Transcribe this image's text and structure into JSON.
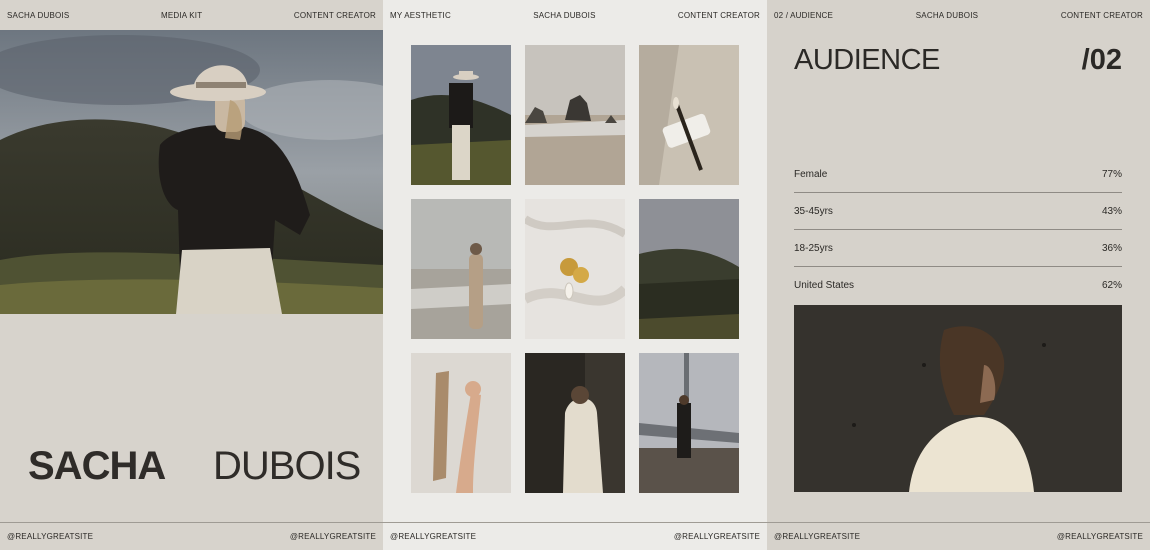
{
  "page1": {
    "header": {
      "left": "SACHA DUBOIS",
      "center": "MEDIA KIT",
      "right": "CONTENT CREATOR"
    },
    "first_name": "SACHA",
    "last_name": "DUBOIS",
    "footer": {
      "left": "@REALLYGREATSITE",
      "right": "@REALLYGREATSITE"
    }
  },
  "page2": {
    "header": {
      "left": "MY AESTHETIC",
      "center": "SACHA DUBOIS",
      "right": "CONTENT CREATOR"
    },
    "footer": {
      "left": "@REALLYGREATSITE",
      "right": "@REALLYGREATSITE"
    }
  },
  "page3": {
    "header": {
      "left": "02 / AUDIENCE",
      "center": "SACHA DUBOIS",
      "right": "CONTENT CREATOR"
    },
    "title": "AUDIENCE",
    "number": "/02",
    "stats": [
      {
        "label": "Female",
        "value": "77%"
      },
      {
        "label": "35-45yrs",
        "value": "43%"
      },
      {
        "label": "18-25yrs",
        "value": "36%"
      },
      {
        "label": "United States",
        "value": "62%"
      }
    ],
    "footer": {
      "left": "@REALLYGREATSITE",
      "right": "@REALLYGREATSITE"
    }
  },
  "colors": {
    "page_bg": "#d7d3cc",
    "gallery_bg": "#ecebe8",
    "text": "#2b2926",
    "rule": "#8f8b85"
  }
}
